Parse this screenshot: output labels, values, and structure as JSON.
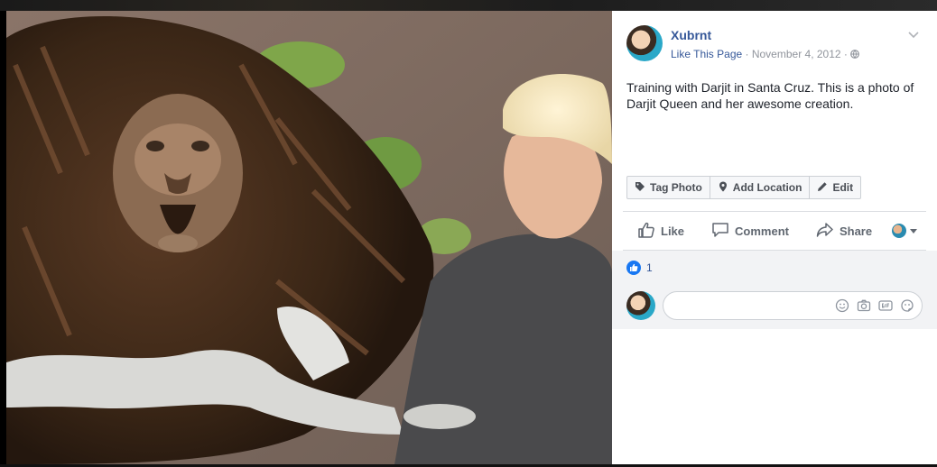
{
  "post": {
    "author": "Xubrnt",
    "like_page": "Like This Page",
    "separator1": " · ",
    "date": "November 4, 2012",
    "separator2": " · ",
    "caption": "Training with Darjit in Santa Cruz. This is a photo of Darjit Queen and her awesome creation.",
    "privacy_icon": "globe-icon",
    "menu_icon": "chevron-down-icon"
  },
  "photo_tools": [
    {
      "label": "Tag Photo",
      "icon": "tag-icon"
    },
    {
      "label": "Add Location",
      "icon": "location-pin-icon"
    },
    {
      "label": "Edit",
      "icon": "pencil-icon"
    }
  ],
  "actions": {
    "like": "Like",
    "comment": "Comment",
    "share": "Share"
  },
  "reactions": {
    "count": "1",
    "icon": "thumbs-up-icon"
  },
  "comment_box": {
    "icons": [
      "emoji-icon",
      "camera-icon",
      "gif-icon",
      "sticker-icon"
    ]
  },
  "colors": {
    "link": "#365899",
    "meta": "#90949c",
    "text": "#1d2129",
    "like_blue": "#1877f2",
    "comment_bg": "#f2f3f5"
  }
}
